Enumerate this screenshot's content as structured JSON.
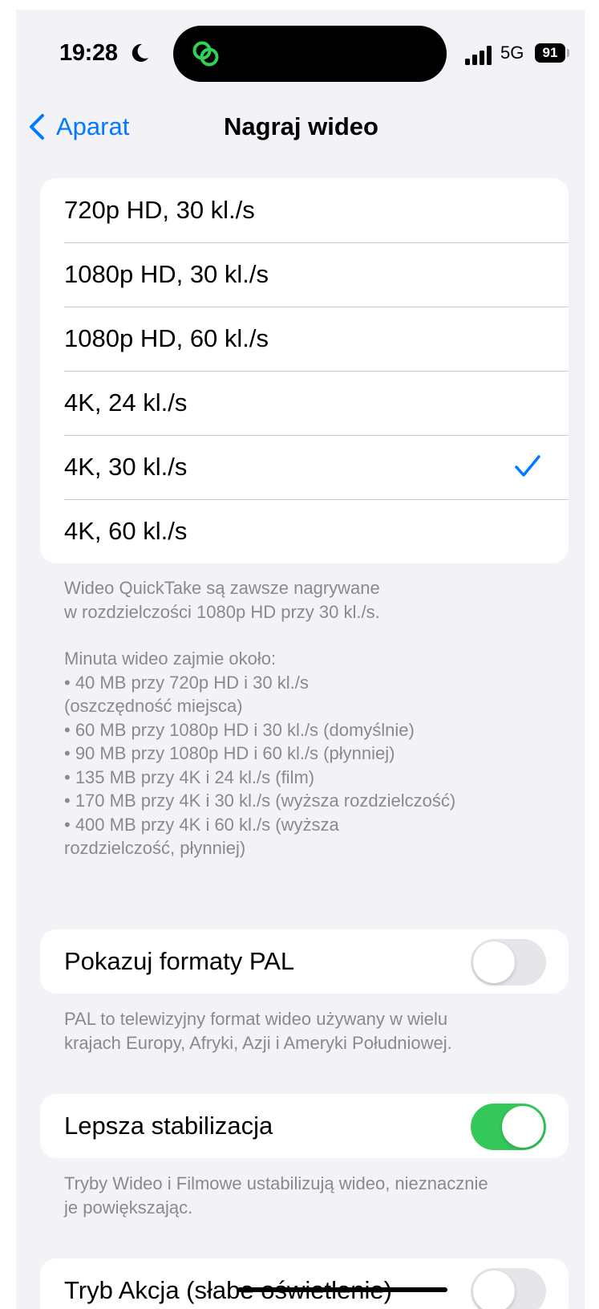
{
  "status_bar": {
    "time": "19:28",
    "network": "5G",
    "battery": "91",
    "icons": [
      "moon-icon",
      "app-activity-icon",
      "signal-icon"
    ]
  },
  "nav": {
    "back_label": "Aparat",
    "title": "Nagraj wideo"
  },
  "colors": {
    "accent": "#007aff",
    "toggle_on": "#34c759",
    "toggle_off": "#e5e5ea",
    "background": "#f2f2f7",
    "footnote": "#8a8a8e"
  },
  "formats": {
    "selected_index": 4,
    "items": [
      {
        "label": "720p HD, 30 kl./s"
      },
      {
        "label": "1080p HD, 30 kl./s"
      },
      {
        "label": "1080p HD, 60 kl./s"
      },
      {
        "label": "4K, 24 kl./s"
      },
      {
        "label": "4K, 30 kl./s"
      },
      {
        "label": "4K, 60 kl./s"
      }
    ]
  },
  "formats_note": {
    "lines": [
      "Wideo QuickTake są zawsze nagrywane",
      "w rozdzielczości 1080p HD przy 30 kl./s.",
      "",
      "Minuta wideo zajmie około:",
      "• 40 MB przy 720p HD i 30 kl./s",
      "(oszczędność miejsca)",
      "• 60 MB przy 1080p HD i 30 kl./s (domyślnie)",
      "• 90 MB przy 1080p HD i 60 kl./s (płynniej)",
      "• 135 MB przy 4K i 24 kl./s (film)",
      "• 170 MB przy 4K i 30 kl./s (wyższa rozdzielczość)",
      "• 400 MB przy 4K i 60 kl./s (wyższa",
      "rozdzielczość, płynniej)"
    ]
  },
  "pal": {
    "label": "Pokazuj formaty PAL",
    "enabled": false,
    "note_lines": [
      "PAL to telewizyjny format wideo używany w wielu",
      "krajach Europy, Afryki, Azji i Ameryki Południowej."
    ]
  },
  "stabilization": {
    "label": "Lepsza stabilizacja",
    "enabled": true,
    "note_lines": [
      "Tryby Wideo i Filmowe ustabilizują wideo, nieznacznie",
      "je powiększając."
    ]
  },
  "action_mode": {
    "label": "Tryb Akcja (słabe oświetlenie)",
    "enabled": false
  }
}
